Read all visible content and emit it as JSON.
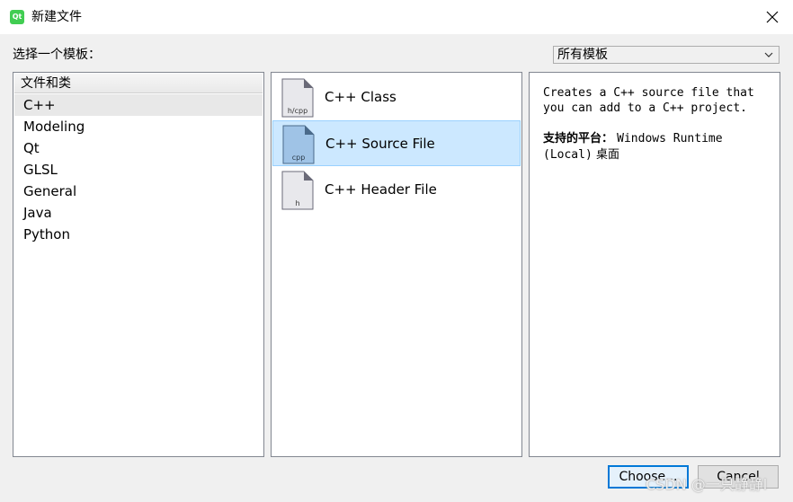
{
  "window": {
    "title": "新建文件",
    "app_icon_text": "Qt"
  },
  "prompt_label": "选择一个模板：",
  "filter": {
    "selected": "所有模板"
  },
  "categories": {
    "header": "文件和类",
    "items": [
      {
        "label": "C++",
        "selected": true
      },
      {
        "label": "Modeling",
        "selected": false
      },
      {
        "label": "Qt",
        "selected": false
      },
      {
        "label": "GLSL",
        "selected": false
      },
      {
        "label": "General",
        "selected": false
      },
      {
        "label": "Java",
        "selected": false
      },
      {
        "label": "Python",
        "selected": false
      }
    ]
  },
  "templates": [
    {
      "label": "C++ Class",
      "icon_text": "h/cpp",
      "icon": "class-file-icon",
      "selected": false
    },
    {
      "label": "C++ Source File",
      "icon_text": "cpp",
      "icon": "source-file-icon",
      "selected": true
    },
    {
      "label": "C++ Header File",
      "icon_text": "h",
      "icon": "header-file-icon",
      "selected": false
    }
  ],
  "description": {
    "text": "Creates a C++ source file that\nyou can add to a C++ project.",
    "platforms_label": "支持的平台：",
    "platforms_value": "Windows Runtime (Local)",
    "platforms_extra": "桌面"
  },
  "buttons": {
    "choose": "Choose...",
    "cancel": "Cancel"
  },
  "watermark": "CSDN @一只静静l",
  "colors": {
    "selection": "#cce8ff",
    "selection_border": "#99d1ff",
    "accent": "#0078d7",
    "qt_green": "#41cd52"
  }
}
